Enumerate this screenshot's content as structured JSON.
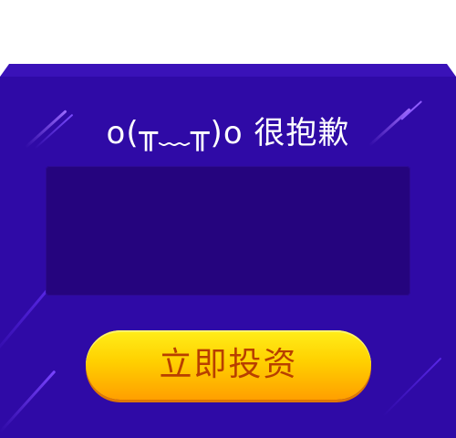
{
  "dialog": {
    "title": "o(╥﹏╥)o 很抱歉",
    "message": "",
    "button_label": "立即投资"
  },
  "colors": {
    "card_background": "#2f0aa6",
    "panel_background": "#25047e",
    "button_gradient_top": "#ffee1a",
    "button_gradient_bottom": "#ff9f00",
    "button_text": "#b83f00",
    "title_text": "#ffffff"
  }
}
